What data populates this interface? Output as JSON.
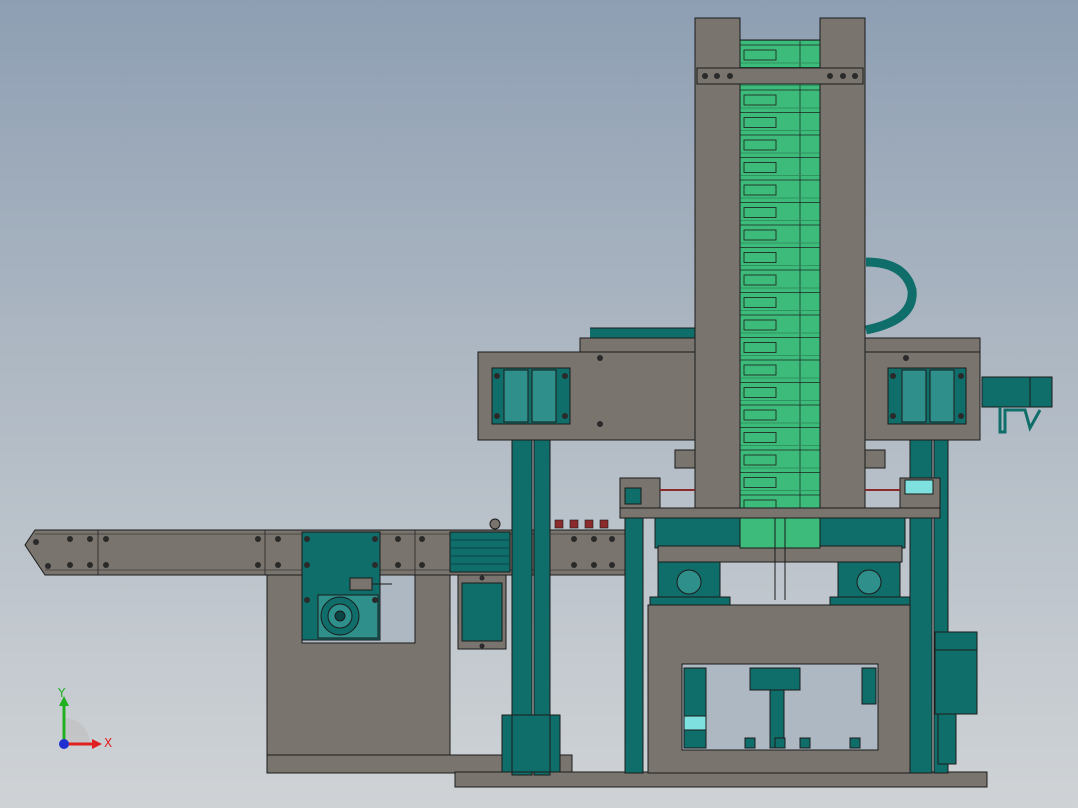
{
  "view": {
    "title": "",
    "background_top": "#8e9fb3",
    "background_bottom": "#cfd3d6"
  },
  "colors": {
    "steel": "#7a746e",
    "teal": "#0f6d6a",
    "teal_light": "#2e8f8b",
    "green": "#3dbb7a",
    "outline": "#1b1b1b",
    "cyan": "#7fe0e0"
  },
  "triad": {
    "x_label": "X",
    "y_label": "Y",
    "x_color": "#e02020",
    "y_color": "#20b020",
    "z_color": "#2030d0"
  },
  "icons": [
    "coordinate-triad-icon"
  ]
}
